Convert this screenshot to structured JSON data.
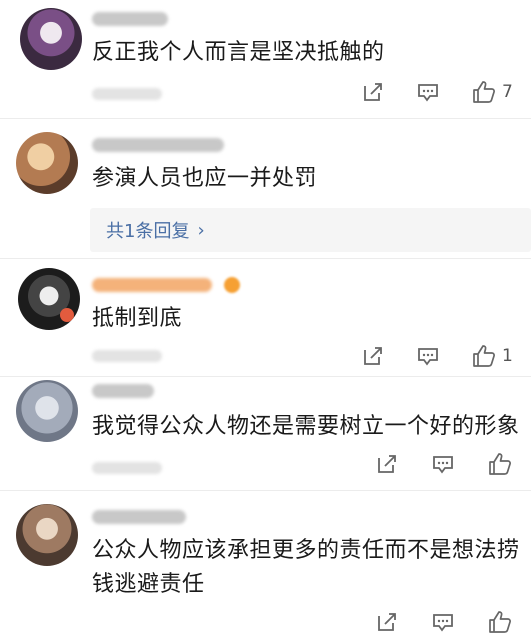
{
  "comments": [
    {
      "text": "反正我个人而言是坚决抵触的",
      "likes": "7"
    },
    {
      "text": "参演人员也应一并处罚",
      "reply_label": "共1条回复",
      "reply_chevron": "›"
    },
    {
      "text": "抵制到底",
      "likes": "1"
    },
    {
      "text": "我觉得公众人物还是需要树立一个好的形象",
      "likes": ""
    },
    {
      "text_line1": "公众人物应该承担更多的责任而不是想法捞",
      "text_line2": "钱逃避责任",
      "likes": ""
    }
  ],
  "icons": {
    "share": "share-icon",
    "comment": "comment-icon",
    "like": "thumbs-up-icon"
  },
  "colors": {
    "text": "#1a1a1a",
    "reply_link": "#4a6fa5",
    "icon": "#666666",
    "divider": "#ececec"
  }
}
